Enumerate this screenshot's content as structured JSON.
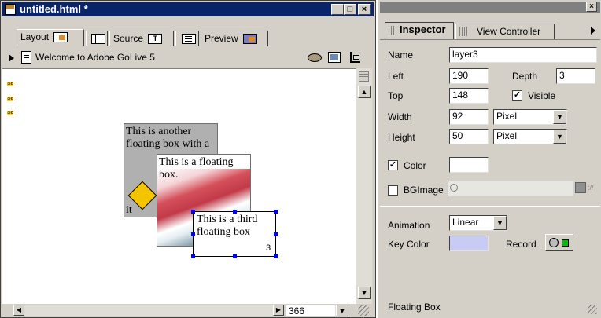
{
  "document_window": {
    "title": "untitled.html *",
    "tabs": {
      "layout": "Layout",
      "source": "Source",
      "preview": "Preview"
    },
    "page_title": "Welcome to Adobe GoLive 5",
    "floating_boxes": [
      {
        "text": "This is another floating box with a",
        "tail": "it"
      },
      {
        "text": "This is a floating box."
      },
      {
        "text": "This is a third floating box",
        "index": "3"
      }
    ],
    "markers": [
      "SB",
      "SB",
      "SB"
    ],
    "width_value": "366"
  },
  "inspector": {
    "tabs": {
      "inspector": "Inspector",
      "view_controller": "View Controller"
    },
    "fields": {
      "name_label": "Name",
      "name_value": "layer3",
      "left_label": "Left",
      "left_value": "190",
      "depth_label": "Depth",
      "depth_value": "3",
      "top_label": "Top",
      "top_value": "148",
      "visible_label": "Visible",
      "width_label": "Width",
      "width_value": "92",
      "width_unit": "Pixel",
      "height_label": "Height",
      "height_value": "50",
      "height_unit": "Pixel",
      "color_label": "Color",
      "bgimage_label": "BGImage",
      "animation_label": "Animation",
      "animation_value": "Linear",
      "keycolor_label": "Key Color",
      "record_label": "Record"
    },
    "status": "Floating Box",
    "key_color": "#c8ccf4"
  }
}
